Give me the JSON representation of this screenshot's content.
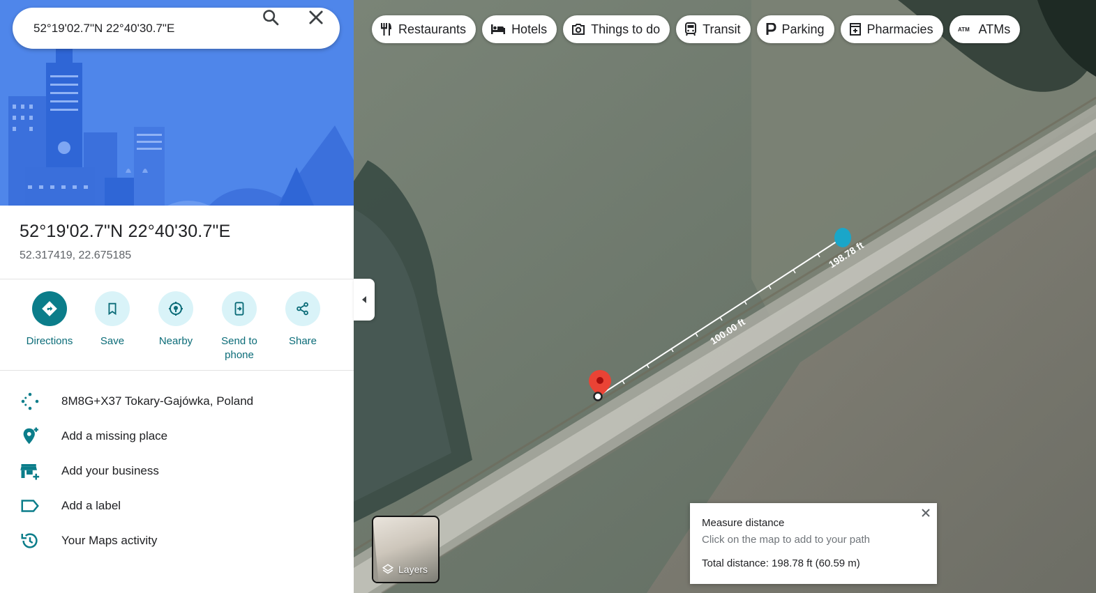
{
  "search": {
    "value": "52°19'02.7\"N 22°40'30.7\"E"
  },
  "place": {
    "title": "52°19'02.7\"N 22°40'30.7\"E",
    "subtitle": "52.317419, 22.675185"
  },
  "actions": [
    {
      "label": "Directions",
      "icon": "directions-icon"
    },
    {
      "label": "Save",
      "icon": "bookmark-icon"
    },
    {
      "label": "Nearby",
      "icon": "nearby-icon"
    },
    {
      "label": "Send to phone",
      "icon": "phone-icon"
    },
    {
      "label": "Share",
      "icon": "share-icon"
    }
  ],
  "details": [
    {
      "label": "8M8G+X37 Tokary-Gajówka, Poland",
      "icon": "plus-code-icon"
    },
    {
      "label": "Add a missing place",
      "icon": "add-place-icon"
    },
    {
      "label": "Add your business",
      "icon": "add-business-icon"
    },
    {
      "label": "Add a label",
      "icon": "label-icon"
    },
    {
      "label": "Your Maps activity",
      "icon": "history-icon"
    }
  ],
  "chips": [
    {
      "label": "Restaurants",
      "icon": "restaurant-icon"
    },
    {
      "label": "Hotels",
      "icon": "hotel-icon"
    },
    {
      "label": "Things to do",
      "icon": "camera-icon"
    },
    {
      "label": "Transit",
      "icon": "transit-icon"
    },
    {
      "label": "Parking",
      "icon": "parking-icon"
    },
    {
      "label": "Pharmacies",
      "icon": "pharmacy-icon"
    },
    {
      "label": "ATMs",
      "icon": "atm-icon"
    }
  ],
  "map": {
    "distance_marker_1": "100.00 ft",
    "distance_marker_2": "198.78 ft",
    "pin_color": "#ea4335",
    "endpoint_color": "#1aa6c9"
  },
  "layers": {
    "label": "Layers"
  },
  "measure": {
    "title": "Measure distance",
    "hint": "Click on the map to add to your path",
    "total": "Total distance: 198.78 ft (60.59 m)"
  },
  "colors": {
    "accent": "#0b7d8a",
    "hero_blue": "#4b83e8"
  }
}
